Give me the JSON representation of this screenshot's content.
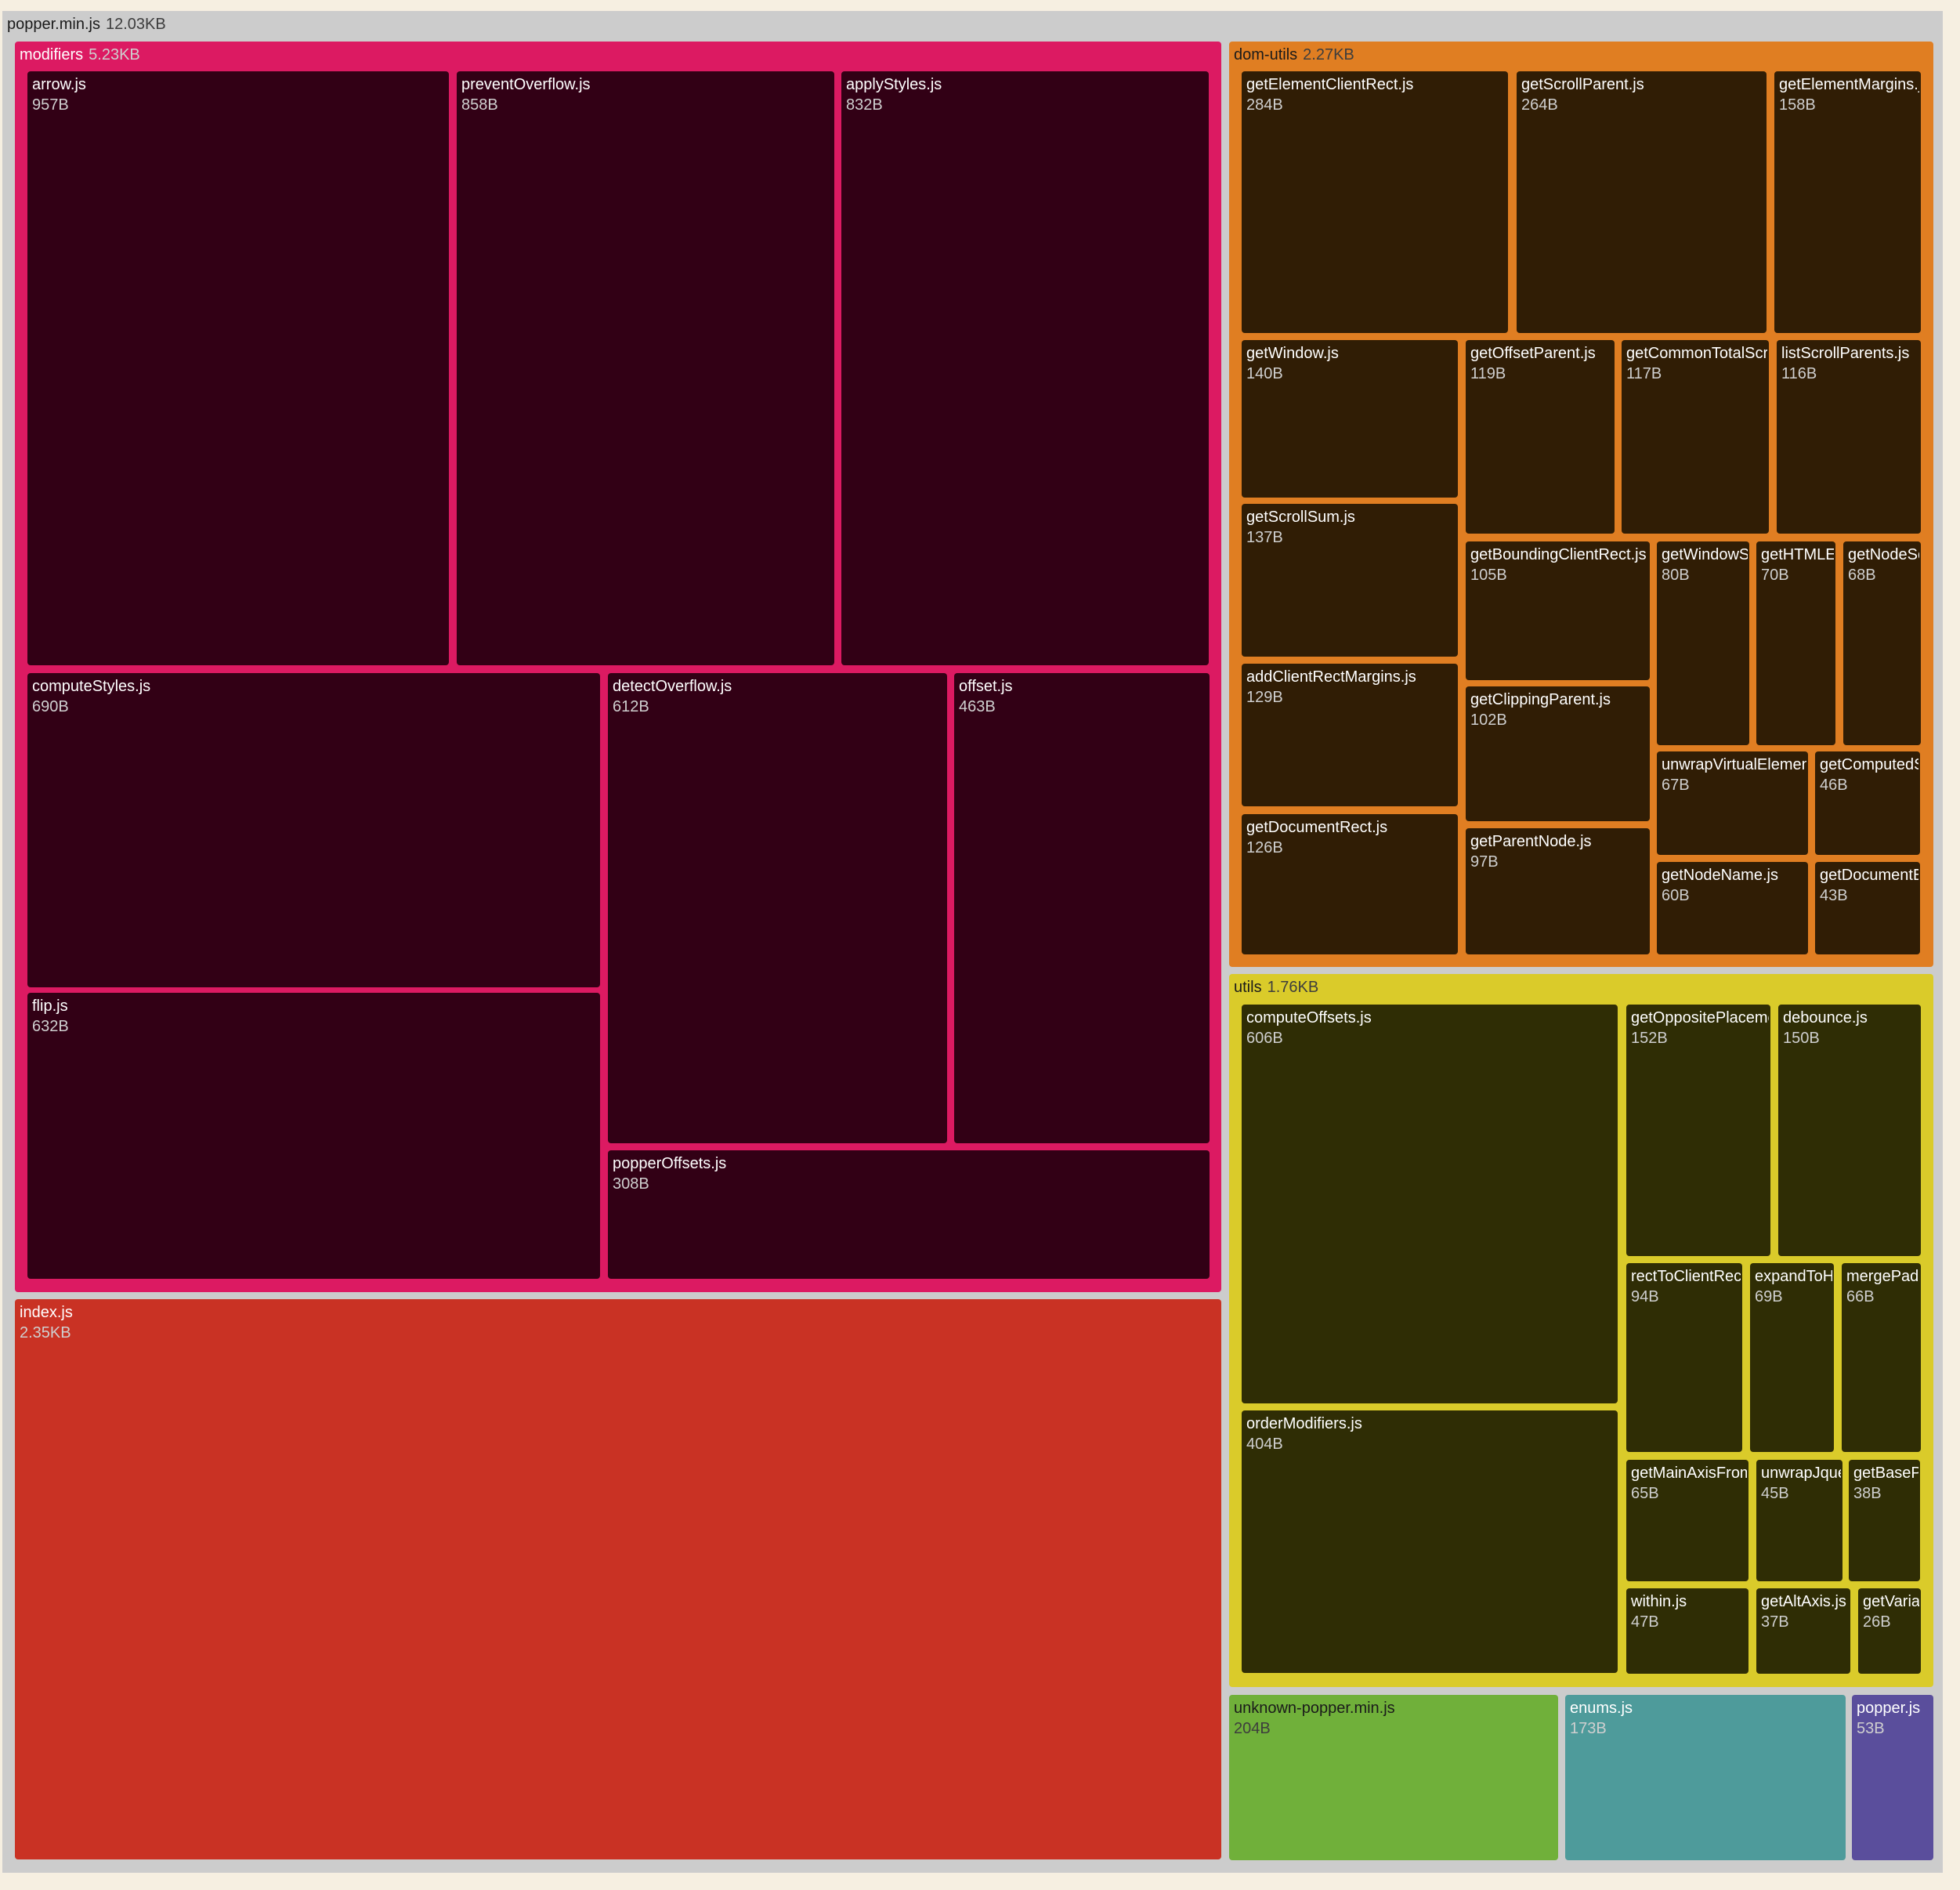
{
  "chart_data": {
    "type": "treemap",
    "unit": "bytes",
    "root": {
      "name": "popper.min.js",
      "size_label": "12.03KB",
      "color": "#cccccc",
      "children": [
        {
          "name": "modifiers",
          "size_label": "5.23KB",
          "color": "#dc1a62",
          "leaf_color": "#320015",
          "children": [
            {
              "name": "arrow.js",
              "size_label": "957B",
              "value": 957
            },
            {
              "name": "preventOverflow.js",
              "size_label": "858B",
              "value": 858
            },
            {
              "name": "applyStyles.js",
              "size_label": "832B",
              "value": 832
            },
            {
              "name": "computeStyles.js",
              "size_label": "690B",
              "value": 690
            },
            {
              "name": "flip.js",
              "size_label": "632B",
              "value": 632
            },
            {
              "name": "detectOverflow.js",
              "size_label": "612B",
              "value": 612
            },
            {
              "name": "offset.js",
              "size_label": "463B",
              "value": 463
            },
            {
              "name": "popperOffsets.js",
              "size_label": "308B",
              "value": 308
            }
          ]
        },
        {
          "name": "index.js",
          "size_label": "2.35KB",
          "value": 2406,
          "color": "#c93224"
        },
        {
          "name": "dom-utils",
          "size_label": "2.27KB",
          "color": "#e07e22",
          "leaf_color": "#301d05",
          "children": [
            {
              "name": "getElementClientRect.js",
              "size_label": "284B",
              "value": 284
            },
            {
              "name": "getScrollParent.js",
              "size_label": "264B",
              "value": 264
            },
            {
              "name": "getElementMargins.js",
              "size_label": "158B",
              "value": 158
            },
            {
              "name": "getWindow.js",
              "size_label": "140B",
              "value": 140
            },
            {
              "name": "getScrollSum.js",
              "size_label": "137B",
              "value": 137
            },
            {
              "name": "addClientRectMargins.js",
              "size_label": "129B",
              "value": 129
            },
            {
              "name": "getDocumentRect.js",
              "size_label": "126B",
              "value": 126
            },
            {
              "name": "getOffsetParent.js",
              "size_label": "119B",
              "value": 119
            },
            {
              "name": "getCommonTotalScroll.js",
              "size_label": "117B",
              "value": 117
            },
            {
              "name": "listScrollParents.js",
              "size_label": "116B",
              "value": 116
            },
            {
              "name": "getBoundingClientRect.js",
              "size_label": "105B",
              "value": 105
            },
            {
              "name": "getClippingParent.js",
              "size_label": "102B",
              "value": 102
            },
            {
              "name": "getParentNode.js",
              "size_label": "97B",
              "value": 97
            },
            {
              "name": "getWindowScroll.js",
              "size_label": "80B",
              "value": 80
            },
            {
              "name": "getHTMLElementScroll.js",
              "size_label": "70B",
              "value": 70
            },
            {
              "name": "getNodeScroll.js",
              "size_label": "68B",
              "value": 68
            },
            {
              "name": "unwrapVirtualElement.js",
              "size_label": "67B",
              "value": 67
            },
            {
              "name": "getComputedStyle.js",
              "size_label": "46B",
              "value": 46
            },
            {
              "name": "getNodeName.js",
              "size_label": "60B",
              "value": 60
            },
            {
              "name": "getDocumentElement.js",
              "size_label": "43B",
              "value": 43
            }
          ]
        },
        {
          "name": "utils",
          "size_label": "1.76KB",
          "color": "#dacb2a",
          "leaf_color": "#2f2d05",
          "children": [
            {
              "name": "computeOffsets.js",
              "size_label": "606B",
              "value": 606
            },
            {
              "name": "orderModifiers.js",
              "size_label": "404B",
              "value": 404
            },
            {
              "name": "getOppositePlacement.js",
              "size_label": "152B",
              "value": 152
            },
            {
              "name": "debounce.js",
              "size_label": "150B",
              "value": 150
            },
            {
              "name": "rectToClientRect.js",
              "size_label": "94B",
              "value": 94
            },
            {
              "name": "expandToHashMap.js",
              "size_label": "69B",
              "value": 69
            },
            {
              "name": "mergePaddingObject.js",
              "size_label": "66B",
              "value": 66
            },
            {
              "name": "getMainAxisFromPlacement.js",
              "size_label": "65B",
              "value": 65
            },
            {
              "name": "unwrapJqueryElement.js",
              "size_label": "45B",
              "value": 45
            },
            {
              "name": "getBasePlacement.js",
              "size_label": "38B",
              "value": 38
            },
            {
              "name": "within.js",
              "size_label": "47B",
              "value": 47
            },
            {
              "name": "getAltAxis.js",
              "size_label": "37B",
              "value": 37
            },
            {
              "name": "getVariation.js",
              "size_label": "26B",
              "value": 26
            }
          ]
        },
        {
          "name": "unknown-popper.min.js",
          "size_label": "204B",
          "value": 204,
          "color": "#70b03a"
        },
        {
          "name": "enums.js",
          "size_label": "173B",
          "value": 173,
          "color": "#4e9b9b"
        },
        {
          "name": "popper.js",
          "size_label": "53B",
          "value": 53,
          "color": "#5a4e9c"
        }
      ]
    }
  }
}
